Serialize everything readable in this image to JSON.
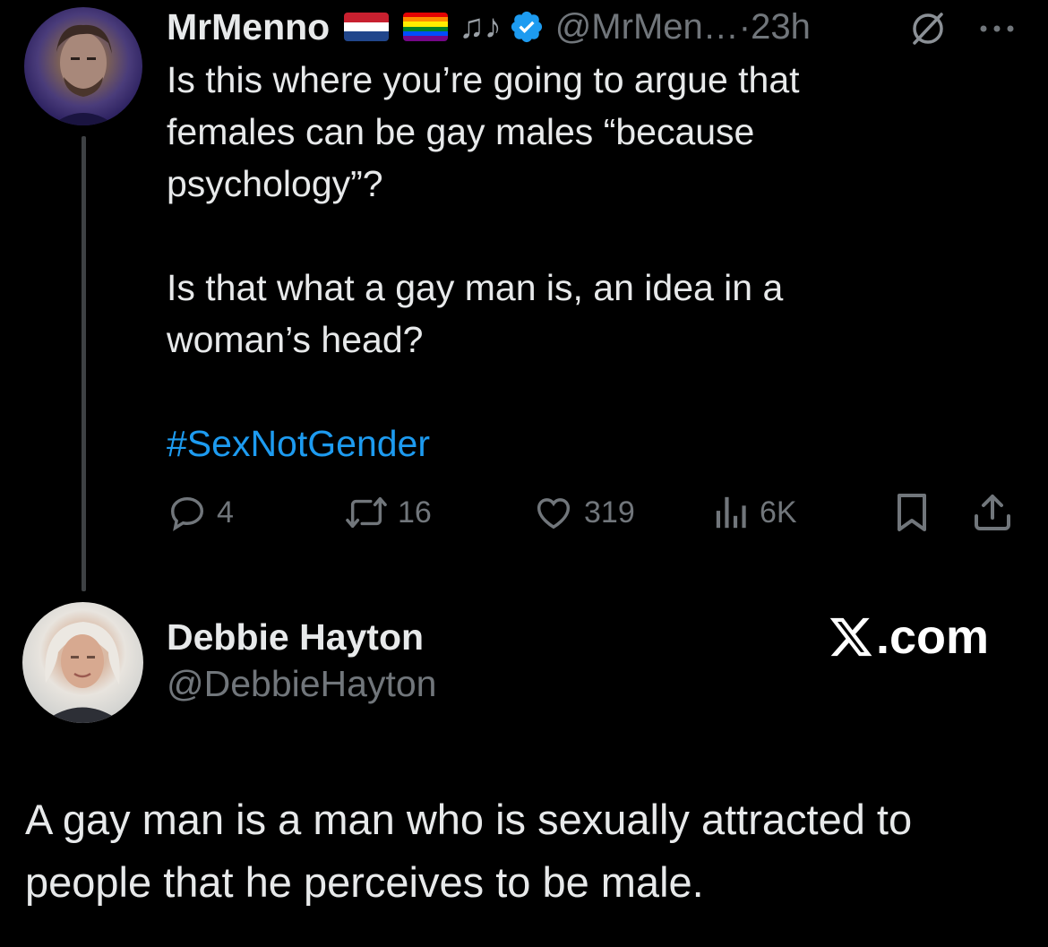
{
  "parent_tweet": {
    "display_name": "MrMenno",
    "flags": [
      "netherlands-flag",
      "rainbow-flag"
    ],
    "notes_glyph": "♫♪",
    "verified": true,
    "handle_time": "@MrMen…·23h",
    "text_lines": [
      "Is this where you’re going to argue that",
      "females can be gay males “because",
      "psychology”?"
    ],
    "text_lines_2": [
      "Is that what a gay man is, an idea in a",
      "woman’s head?"
    ],
    "hashtag": "#SexNotGender",
    "actions": {
      "replies": "4",
      "reposts": "16",
      "likes": "319",
      "views": "6K"
    }
  },
  "reply_tweet": {
    "display_name": "Debbie Hayton",
    "handle": "@DebbieHayton",
    "brand_text": ".com",
    "text_lines": [
      "A gay man is a man who is sexually attracted to",
      "people that he perceives to be male."
    ]
  },
  "colors": {
    "background": "#000000",
    "text": "#e7e9ea",
    "secondary": "#71767b",
    "link": "#1d9bf0",
    "verified": "#1d9bf0"
  }
}
